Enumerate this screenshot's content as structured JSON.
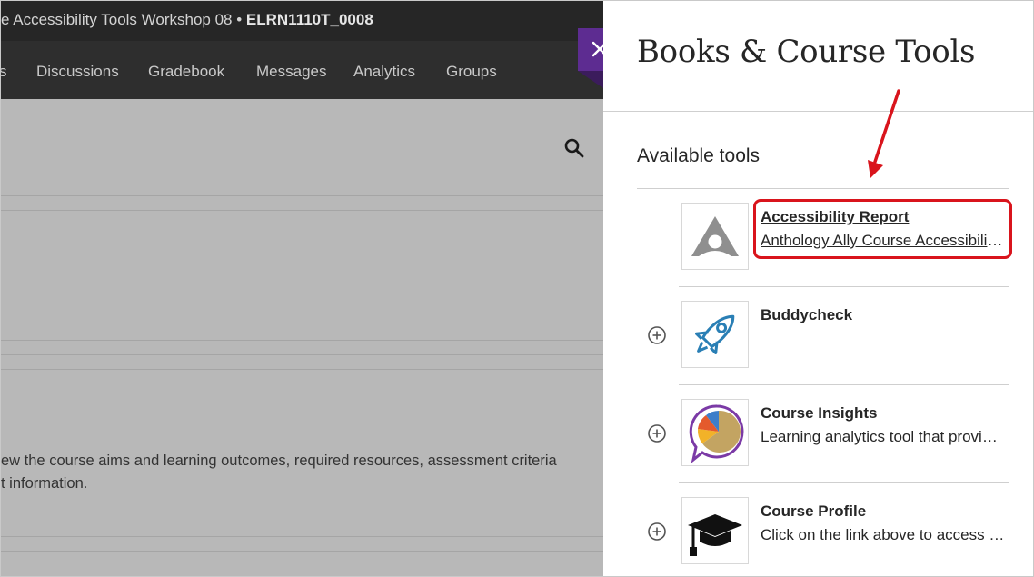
{
  "course": {
    "title": "e Accessibility Tools Workshop 08 • ",
    "code": "ELRN1110T_0008"
  },
  "nav": {
    "items": [
      "s",
      "Discussions",
      "Gradebook",
      "Messages",
      "Analytics",
      "Groups"
    ]
  },
  "background_text": {
    "line1": "ew the course aims and learning outcomes, required resources, assessment criteria",
    "line2": "t information."
  },
  "panel": {
    "close_icon": "close-x-icon",
    "title": "Books & Course Tools",
    "section_heading": "Available tools",
    "tools": [
      {
        "name": "Accessibility Report",
        "description": "Anthology Ally Course Accessibility Report",
        "icon": "ally-logo-icon",
        "linked": true
      },
      {
        "name": "Buddycheck",
        "description": "",
        "icon": "rocket-icon",
        "linked": false
      },
      {
        "name": "Course Insights",
        "description": "Learning analytics tool that provides",
        "icon": "pie-chart-speech-icon",
        "linked": false
      },
      {
        "name": "Course Profile",
        "description": "Click on the link above to access the course profile",
        "icon": "graduation-cap-icon",
        "linked": false
      }
    ]
  },
  "colors": {
    "accent": "#5d2c91",
    "highlight": "#d9141c",
    "topbar": "#262626"
  }
}
